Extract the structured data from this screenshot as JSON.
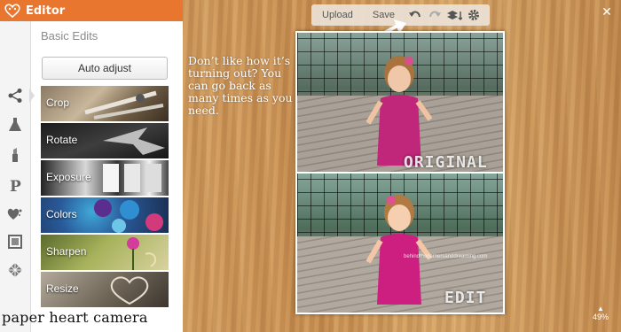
{
  "app": {
    "title": "Editor"
  },
  "panel": {
    "section_title": "Basic Edits",
    "auto_adjust": "Auto adjust",
    "tools": [
      {
        "label": "Crop"
      },
      {
        "label": "Rotate"
      },
      {
        "label": "Exposure"
      },
      {
        "label": "Colors"
      },
      {
        "label": "Sharpen"
      },
      {
        "label": "Resize"
      }
    ],
    "sidebar_icons": [
      "edit-nodes-icon",
      "effects-flask-icon",
      "touch-up-lipstick-icon",
      "text-p-icon",
      "overlays-heart-icon",
      "frames-square-icon",
      "textures-diamond-icon"
    ]
  },
  "toolbar": {
    "upload": "Upload",
    "save": "Save"
  },
  "overlay_text": "Don’t like how it’s turning out? You can go back as many times as you need.",
  "photo": {
    "label_top": "ORIGINAL",
    "label_bottom": "EDIT",
    "watermark": "behindthecornersanddreaming.com"
  },
  "caption": "paper heart camera",
  "zoom": "49%",
  "colors": {
    "header": "#e8762e",
    "dress": "#c0267a"
  }
}
